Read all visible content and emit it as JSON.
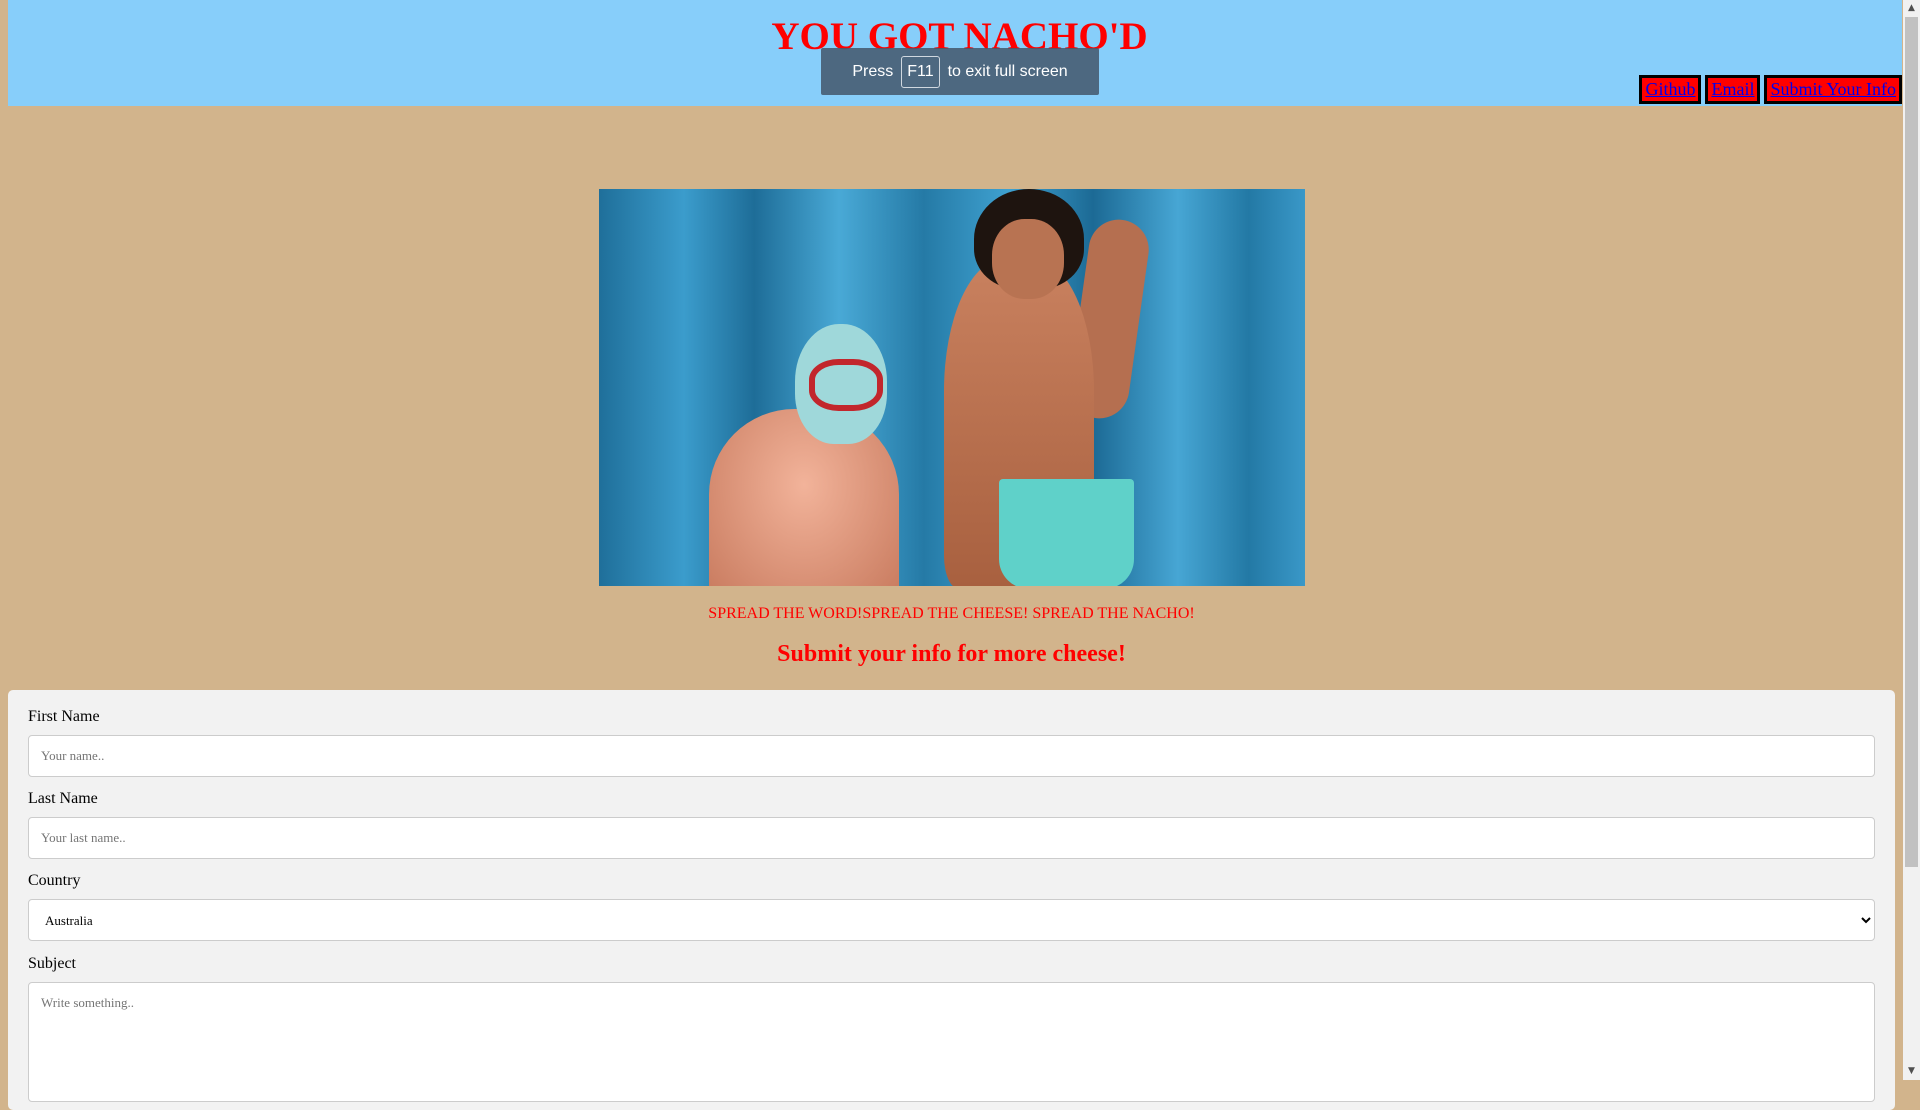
{
  "header": {
    "title": "YOU GOT NACHO'D",
    "nav": [
      {
        "label": "Github"
      },
      {
        "label": "Email"
      },
      {
        "label": "Submit Your Info"
      }
    ]
  },
  "fullscreen_notice": {
    "prefix": "Press",
    "key": "F11",
    "suffix": "to exit full screen"
  },
  "tagline": "SPREAD THE WORD!SPREAD THE CHEESE! SPREAD THE NACHO!",
  "form": {
    "heading": "Submit your info for more cheese!",
    "first_name": {
      "label": "First Name",
      "placeholder": "Your name.."
    },
    "last_name": {
      "label": "Last Name",
      "placeholder": "Your last name.."
    },
    "country": {
      "label": "Country",
      "selected": "Australia"
    },
    "subject": {
      "label": "Subject",
      "placeholder": "Write something.."
    }
  },
  "colors": {
    "page_bg": "#d2b48c",
    "header_bg": "#87cefa",
    "accent_red": "#ff0000",
    "form_bg": "#f2f2f2"
  }
}
